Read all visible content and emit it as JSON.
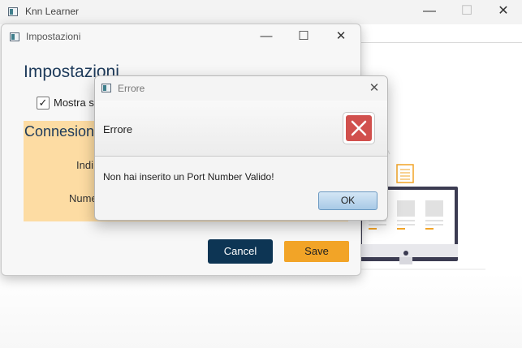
{
  "main_window": {
    "title": "Knn Learner",
    "controls": {
      "minimize": "—",
      "maximize": "☐",
      "close": "✕"
    }
  },
  "settings_window": {
    "title": "Impostazioni",
    "controls": {
      "minimize": "—",
      "maximize": "☐",
      "close": "✕"
    },
    "heading": "Impostazioni",
    "show_checkbox": {
      "checked": true,
      "check_glyph": "✓",
      "label": "Mostra so"
    },
    "connection": {
      "heading": "Connesione",
      "field1_label": "Indi",
      "field2_label": "Nume"
    },
    "cancel_label": "Cancel",
    "save_label": "Save"
  },
  "error_dialog": {
    "title": "Errore",
    "close_glyph": "✕",
    "header_text": "Errore",
    "message": "Non hai inserito un Port Number Valido!",
    "ok_label": "OK"
  },
  "colors": {
    "accent_dark": "#0d3554",
    "accent_orange": "#f2a427",
    "panel_background": "#fddca3",
    "error_red": "#d1504d"
  }
}
